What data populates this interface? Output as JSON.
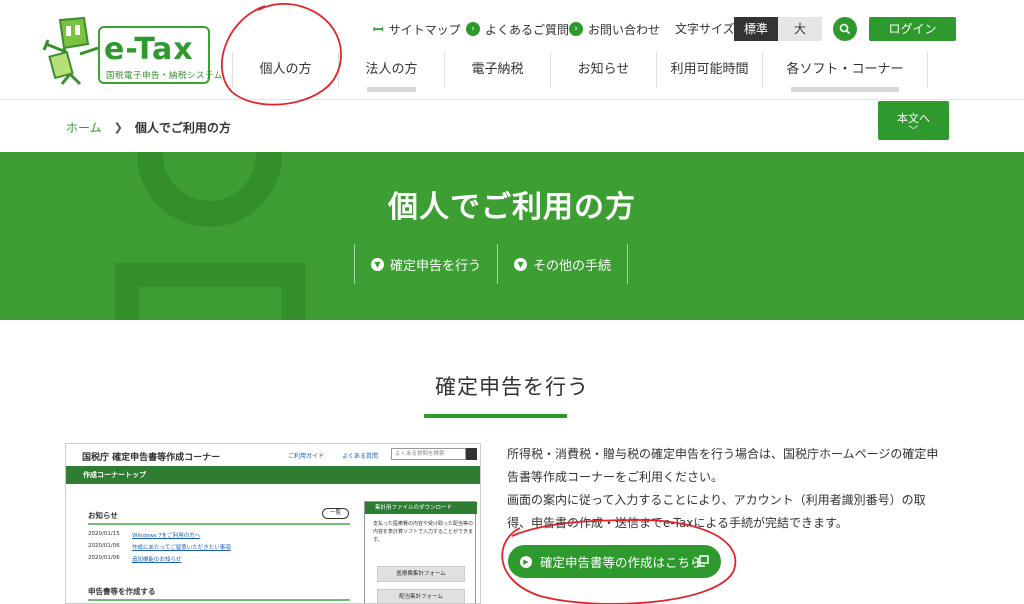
{
  "logo": {
    "title": "e-Tax",
    "subtitle": "国税電子申告・納税システム"
  },
  "utility": {
    "sitemap": "サイトマップ",
    "faq": "よくあるご質問",
    "contact": "お問い合わせ",
    "font_size_label": "文字サイズ",
    "font_standard": "標準",
    "font_large": "大",
    "login": "ログイン"
  },
  "nav": {
    "items": [
      {
        "label": "個人の方"
      },
      {
        "label": "法人の方"
      },
      {
        "label": "電子納税"
      },
      {
        "label": "お知らせ"
      },
      {
        "label": "利用可能時間"
      },
      {
        "label": "各ソフト・コーナー"
      }
    ]
  },
  "breadcrumb": {
    "home": "ホーム",
    "current": "個人でご利用の方"
  },
  "honbun": "本文へ",
  "hero": {
    "title": "個人でご利用の方",
    "links": [
      "確定申告を行う",
      "その他の手続"
    ]
  },
  "section": {
    "title": "確定申告を行う",
    "description_1": "所得税・消費税・贈与税の確定申告を行う場合は、国税庁ホームページの確定申告書等作成コーナーをご利用ください。",
    "description_2": "画面の案内に従って入力することにより、アカウント（利用者識別番号）の取得、申告書の作成・送信までe-Taxによる手続が完結できます。",
    "cta": "確定申告書等の作成はこちら"
  },
  "thumbnail": {
    "title": "国税庁 確定申告書等作成コーナー",
    "guide": "ご利用ガイド",
    "faq": "よくある質問",
    "search_placeholder": "よくある質問を検索",
    "bar": "作成コーナートップ",
    "news": "お知らせ",
    "more": "一覧",
    "news_rows": [
      {
        "date": "2020/01/15",
        "text": "Windows 7をご利用の方へ"
      },
      {
        "date": "2020/01/06",
        "text": "作成にあたってご留意いただきたい事項"
      },
      {
        "date": "2020/01/06",
        "text": "追加機能のお知らせ"
      }
    ],
    "create": "申告書等を作成する",
    "side_head": "集計用ファイルのダウンロード",
    "side_text": "支払った医療費の内容や受け取った配当等の内容を表計算ソフトで入力することができます。",
    "side_buttons": [
      "医療費集計フォーム",
      "配当集計フォーム"
    ]
  },
  "colors": {
    "brand_green": "#2e9a2e",
    "hero_green": "#3c9e33",
    "annotation_red": "#e0242c"
  }
}
